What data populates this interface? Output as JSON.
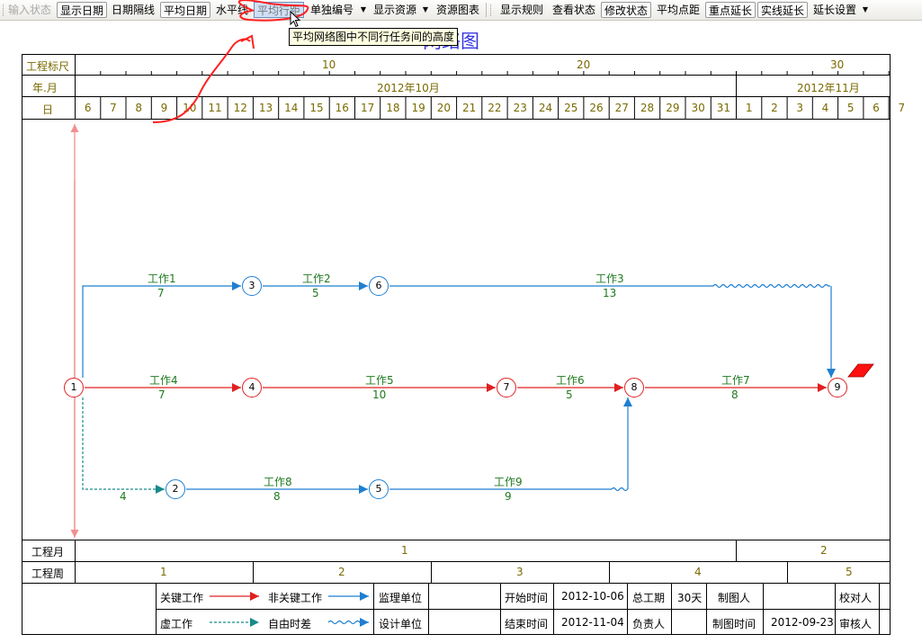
{
  "toolbar": {
    "items": [
      {
        "label": "输入状态",
        "state": "disabled"
      },
      {
        "label": "显示日期",
        "state": "pressed"
      },
      {
        "label": "日期隔线",
        "state": "normal"
      },
      {
        "label": "平均日期",
        "state": "pressed"
      },
      {
        "label": "水平线",
        "state": "normal"
      },
      {
        "label": "平均行距",
        "state": "hover"
      },
      {
        "label": "单独编号",
        "state": "dropdown"
      },
      {
        "label": "显示资源",
        "state": "dropdown"
      },
      {
        "label": "资源图表",
        "state": "normal"
      },
      {
        "label": "显示规则",
        "state": "normal"
      },
      {
        "label": "查看状态",
        "state": "normal"
      },
      {
        "label": "修改状态",
        "state": "pressed"
      },
      {
        "label": "平均点距",
        "state": "normal"
      },
      {
        "label": "重点延长",
        "state": "pressed"
      },
      {
        "label": "实线延长",
        "state": "pressed"
      },
      {
        "label": "延长设置",
        "state": "dropdown"
      }
    ]
  },
  "tooltip": "平均网络图中不同行任务间的高度",
  "title": "网络图",
  "scale": {
    "label": "工程标尺",
    "ticks": [
      "10",
      "20",
      "30"
    ],
    "month_label": "年.月",
    "months": [
      "2012年10月",
      "2012年11月"
    ],
    "day_label": "日",
    "days": [
      "6",
      "7",
      "8",
      "9",
      "10",
      "11",
      "12",
      "13",
      "14",
      "15",
      "16",
      "17",
      "18",
      "19",
      "20",
      "21",
      "22",
      "23",
      "24",
      "25",
      "26",
      "27",
      "28",
      "29",
      "30",
      "31",
      "1",
      "2",
      "3",
      "4",
      "5",
      "6",
      "7"
    ]
  },
  "nodes": [
    "1",
    "2",
    "3",
    "4",
    "5",
    "6",
    "7",
    "8",
    "9"
  ],
  "tasks": [
    {
      "name": "工作1",
      "duration": "7"
    },
    {
      "name": "工作2",
      "duration": "5"
    },
    {
      "name": "工作3",
      "duration": "13"
    },
    {
      "name": "工作4",
      "duration": "7"
    },
    {
      "name": "工作5",
      "duration": "10"
    },
    {
      "name": "工作6",
      "duration": "5"
    },
    {
      "name": "工作7",
      "duration": "8"
    },
    {
      "name": "工作8",
      "duration": "8"
    },
    {
      "name": "工作9",
      "duration": "9"
    }
  ],
  "dummy_duration": "4",
  "project_month": {
    "label": "工程月",
    "values": [
      "1",
      "2"
    ]
  },
  "project_week": {
    "label": "工程周",
    "values": [
      "1",
      "2",
      "3",
      "4",
      "5"
    ]
  },
  "legend": {
    "critical": "关键工作",
    "noncritical": "非关键工作",
    "dummy": "虚工作",
    "free_float": "自由时差"
  },
  "info": {
    "supervisor_label": "监理单位",
    "designer_label": "设计单位",
    "start_label": "开始时间",
    "start_value": "2012-10-06",
    "end_label": "结束时间",
    "end_value": "2012-11-04",
    "duration_label": "总工期",
    "duration_value": "30天",
    "manager_label": "负责人",
    "drafter_label": "制图人",
    "draw_date_label": "制图时间",
    "draw_date_value": "2012-09-23",
    "checker_label": "校对人",
    "reviewer_label": "审核人"
  },
  "colors": {
    "critical": "#e02020",
    "noncritical": "#1f7fd1",
    "dummy": "#178a8a",
    "label": "#1f7a1f",
    "scale_text": "#7a6a00",
    "title": "#3535e0",
    "annotation": "#ff2020"
  }
}
